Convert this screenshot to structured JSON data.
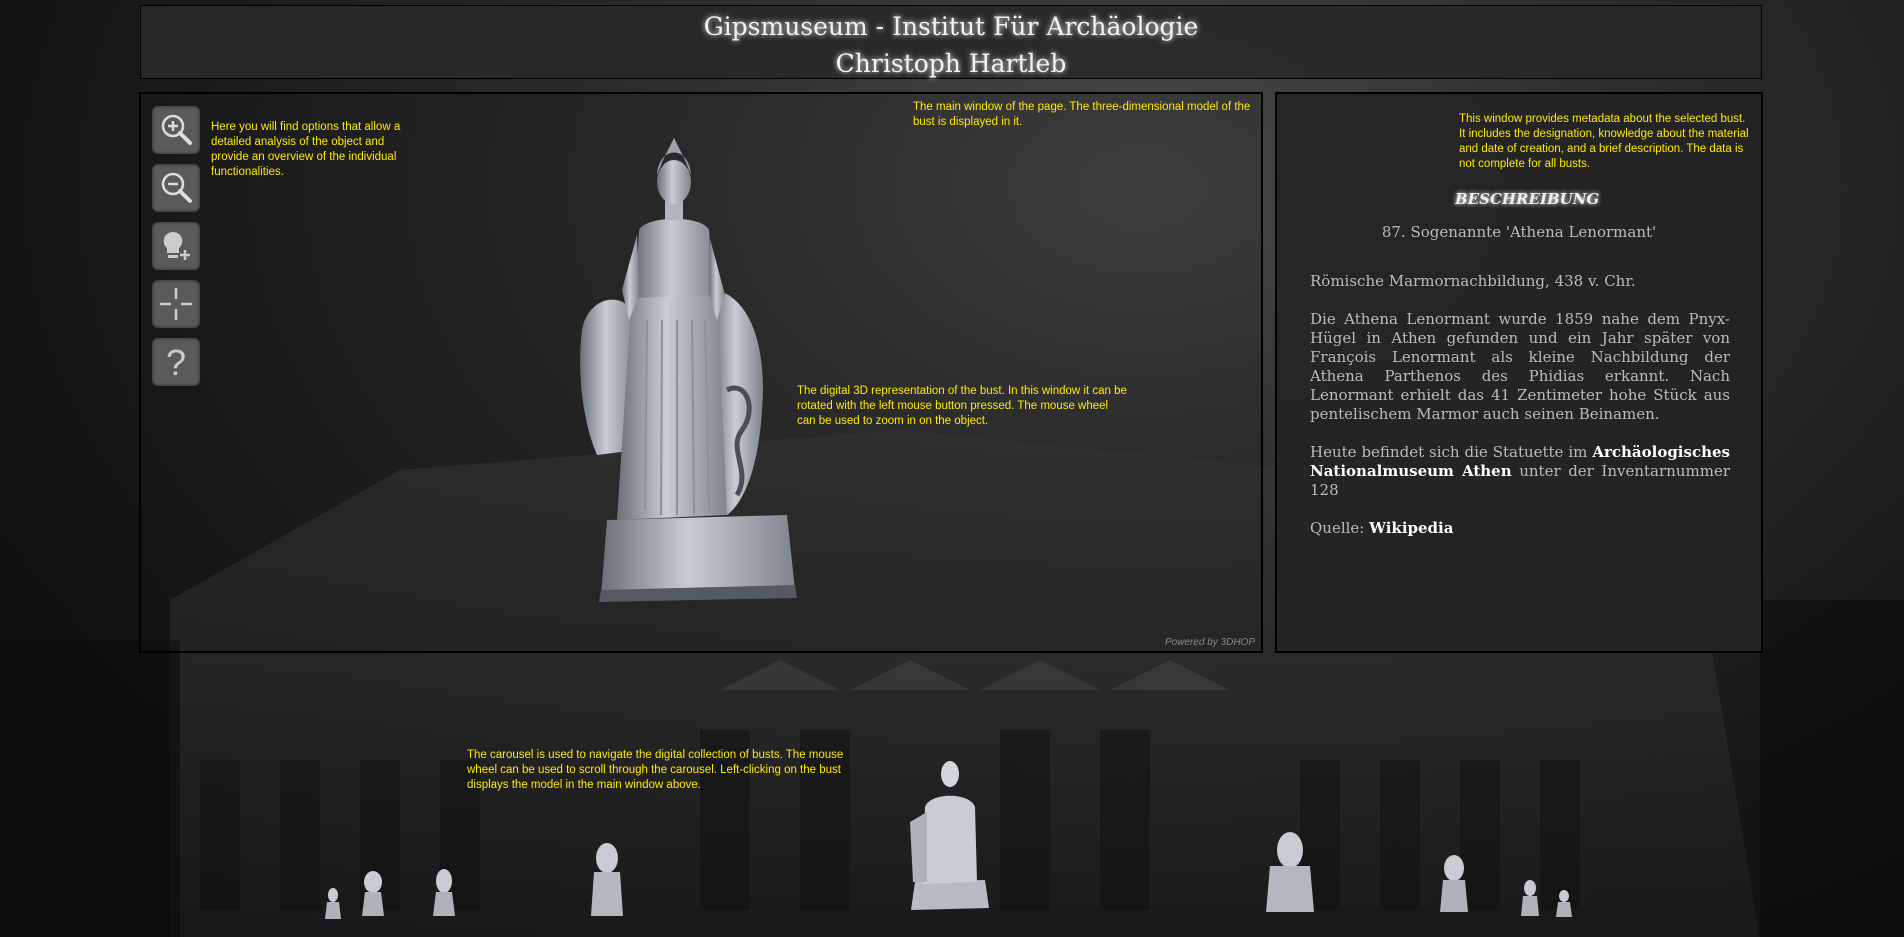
{
  "header": {
    "line1": "Gipsmuseum - Institut Für Archäologie",
    "line2": "Christoph Hartleb"
  },
  "viewer": {
    "tools": [
      {
        "name": "zoom-in-icon"
      },
      {
        "name": "zoom-out-icon"
      },
      {
        "name": "light-icon"
      },
      {
        "name": "center-icon"
      },
      {
        "name": "help-icon"
      }
    ],
    "note_tools": "Here you will find options that allow a detailed analysis of the object and provide an overview of the individual functionalities.",
    "note_main": "The main window of the page. The three-dimensional model of the bust is displayed in it.",
    "note_model": "The digital 3D representation of the bust. In this window it can be rotated with the left mouse button pressed. The mouse wheel can be used to zoom in on the object.",
    "powered_by": "Powered by 3DHOP"
  },
  "info": {
    "note": "This window provides metadata about the selected bust. It includes the designation, knowledge about the material and date of creation, and a brief description. The data is not complete for all busts.",
    "heading": "BESCHREIBUNG",
    "designation": "87. Sogenannte 'Athena Lenormant'",
    "material_date": "Römische Marmornachbildung, 438 v. Chr.",
    "description": "Die Athena Lenormant wurde 1859 nahe dem Pnyx-Hügel in Athen gefunden und ein Jahr später von François Lenormant als kleine Nachbildung der Athena Parthenos des Phidias erkannt. Nach Lenormant erhielt das 41 Zentimeter hohe Stück aus pentelischem Marmor auch seinen Beinamen.",
    "location_prefix": "Heute befindet sich die Statuette im",
    "location_link": "Archäologisches Nationalmuseum Athen",
    "location_suffix": "unter der Inventarnummer 128",
    "source_label": "Quelle:",
    "source_link": "Wikipedia"
  },
  "carousel": {
    "note": "The carousel is used to navigate the digital collection of busts. The mouse wheel can be used to scroll through the carousel. Left-clicking on the bust displays the model in the main window above."
  },
  "colors": {
    "note": "#ffea00",
    "panel": "#242424",
    "link": "#ffffff"
  }
}
